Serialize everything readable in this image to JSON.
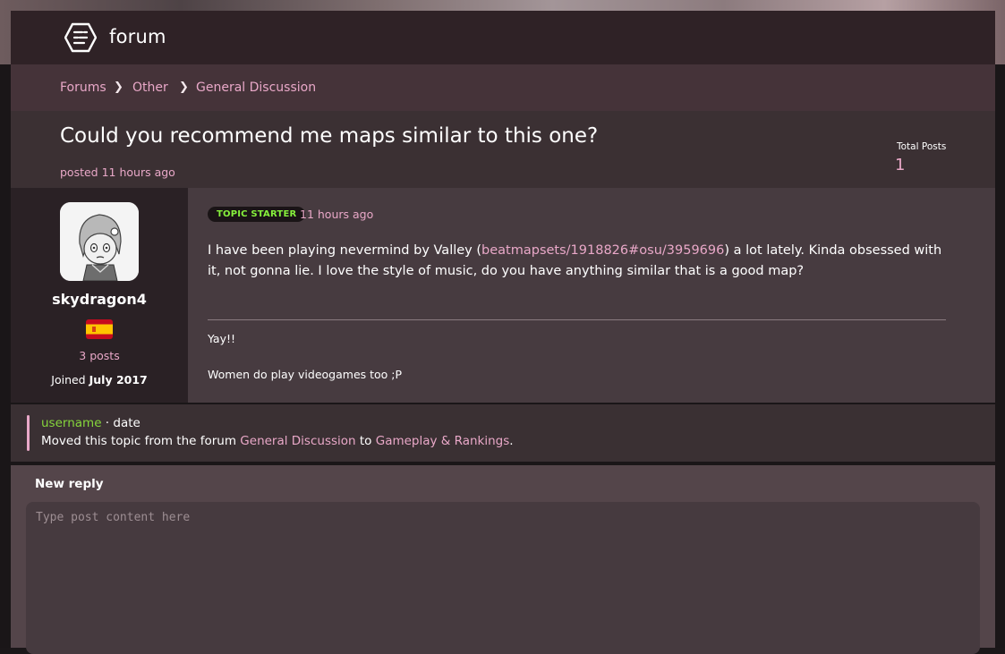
{
  "header": {
    "logo_text": "forum"
  },
  "breadcrumb": {
    "items": [
      "Forums",
      "Other",
      "General Discussion"
    ]
  },
  "topic": {
    "title": "Could you recommend me maps similar to this one?",
    "posted": "posted 11 hours ago",
    "total_posts_label": "Total Posts",
    "total_posts_value": "1"
  },
  "post": {
    "username": "skydragon4",
    "posts_count": "3 posts",
    "joined_prefix": "Joined",
    "joined_date": "July 2017",
    "badge": "TOPIC STARTER",
    "time": "11 hours ago",
    "body_before": "I have been playing nevermind by Valley (",
    "body_link": "beatmapsets/1918826#osu/3959696",
    "body_after": ") a lot lately. Kinda obsessed with it, not gonna lie. I love the style of music, do you have anything similar that is a good map?",
    "signature_line1": "Yay!!",
    "signature_line2": "Women do play videogames too ;P"
  },
  "moved_notice": {
    "username": "username",
    "sep": " · ",
    "date": "date",
    "text_before": "Moved this topic from the forum ",
    "from_forum": "General Discussion",
    "text_mid": " to ",
    "to_forum": "Gameplay & Rankings",
    "text_end": "."
  },
  "reply": {
    "title": "New reply",
    "placeholder": "Type post content here"
  },
  "colors": {
    "accent_pink": "#e9a8c8",
    "accent_green": "#86f03c",
    "header_bg": "#2f2226"
  },
  "icons": {
    "logo": "forum-logo-icon",
    "chevron": "chevron-right-icon",
    "flag": "spain-flag-icon"
  }
}
